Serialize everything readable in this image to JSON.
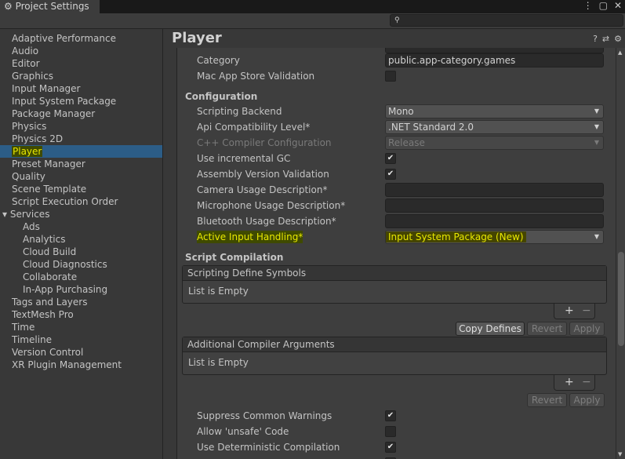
{
  "window": {
    "title": "Project Settings",
    "controls": [
      "⋮",
      "▢",
      "✕"
    ]
  },
  "search": {
    "placeholder": "",
    "icon": "⚲"
  },
  "sidebar": {
    "items": [
      {
        "label": "Adaptive Performance"
      },
      {
        "label": "Audio"
      },
      {
        "label": "Editor"
      },
      {
        "label": "Graphics"
      },
      {
        "label": "Input Manager"
      },
      {
        "label": "Input System Package"
      },
      {
        "label": "Package Manager"
      },
      {
        "label": "Physics"
      },
      {
        "label": "Physics 2D"
      },
      {
        "label": "Player",
        "selected": true
      },
      {
        "label": "Preset Manager"
      },
      {
        "label": "Quality"
      },
      {
        "label": "Scene Template"
      },
      {
        "label": "Script Execution Order"
      },
      {
        "label": "Services",
        "expanded": true
      },
      {
        "label": "Ads",
        "sub": true
      },
      {
        "label": "Analytics",
        "sub": true
      },
      {
        "label": "Cloud Build",
        "sub": true
      },
      {
        "label": "Cloud Diagnostics",
        "sub": true
      },
      {
        "label": "Collaborate",
        "sub": true
      },
      {
        "label": "In-App Purchasing",
        "sub": true
      },
      {
        "label": "Tags and Layers"
      },
      {
        "label": "TextMesh Pro"
      },
      {
        "label": "Time"
      },
      {
        "label": "Timeline"
      },
      {
        "label": "Version Control"
      },
      {
        "label": "XR Plugin Management"
      }
    ]
  },
  "page": {
    "title": "Player",
    "header_icons": [
      "?",
      "⇄",
      "⚙"
    ]
  },
  "settings": {
    "category": {
      "label": "Category",
      "value": "public.app-category.games"
    },
    "mac_validation": {
      "label": "Mac App Store Validation",
      "checked": false
    },
    "configuration": "Configuration",
    "scripting_backend": {
      "label": "Scripting Backend",
      "value": "Mono"
    },
    "api_level": {
      "label": "Api Compatibility Level*",
      "value": ".NET Standard 2.0"
    },
    "cpp_config": {
      "label": "C++ Compiler Configuration",
      "value": "Release"
    },
    "incremental_gc": {
      "label": "Use incremental GC",
      "checked": true
    },
    "assembly_validation": {
      "label": "Assembly Version Validation",
      "checked": true
    },
    "camera_desc": {
      "label": "Camera Usage Description*",
      "value": ""
    },
    "mic_desc": {
      "label": "Microphone Usage Description*",
      "value": ""
    },
    "bt_desc": {
      "label": "Bluetooth Usage Description*",
      "value": ""
    },
    "input_handling": {
      "label": "Active Input Handling*",
      "value": "Input System Package (New)"
    },
    "script_compilation": "Script Compilation",
    "define_symbols": {
      "header": "Scripting Define Symbols",
      "empty": "List is Empty",
      "add": "+",
      "remove": "−",
      "copy": "Copy Defines",
      "revert": "Revert",
      "apply": "Apply"
    },
    "compiler_args": {
      "header": "Additional Compiler Arguments",
      "empty": "List is Empty",
      "add": "+",
      "remove": "−",
      "revert": "Revert",
      "apply": "Apply"
    },
    "suppress_warnings": {
      "label": "Suppress Common Warnings",
      "checked": true
    },
    "unsafe_code": {
      "label": "Allow 'unsafe' Code",
      "checked": false
    },
    "deterministic": {
      "label": "Use Deterministic Compilation",
      "checked": true
    }
  },
  "check_glyph": "✔",
  "arrow_glyph": "▼"
}
